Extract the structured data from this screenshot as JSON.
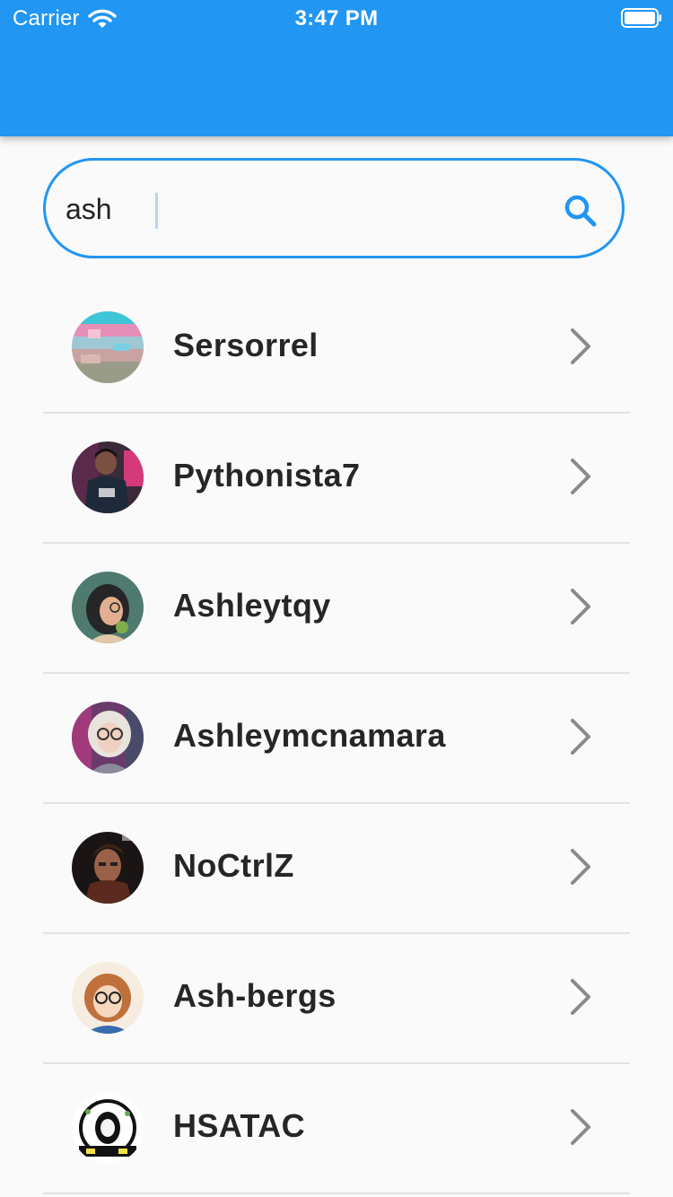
{
  "status_bar": {
    "carrier": "Carrier",
    "time": "3:47 PM"
  },
  "search": {
    "value": "ash",
    "placeholder": ""
  },
  "results": [
    {
      "username": "Sersorrel"
    },
    {
      "username": "Pythonista7"
    },
    {
      "username": "Ashleytqy"
    },
    {
      "username": "Ashleymcnamara"
    },
    {
      "username": "NoCtrlZ"
    },
    {
      "username": "Ash-bergs"
    },
    {
      "username": "HSATAC"
    }
  ],
  "colors": {
    "accent": "#2196f3",
    "background": "#fafafa",
    "divider": "#e2e2e2",
    "chevron": "#8a8a8a",
    "text": "#262626"
  },
  "icons": {
    "search": "search-icon",
    "chevron": "chevron-right-icon",
    "wifi": "wifi-icon",
    "battery": "battery-icon"
  }
}
